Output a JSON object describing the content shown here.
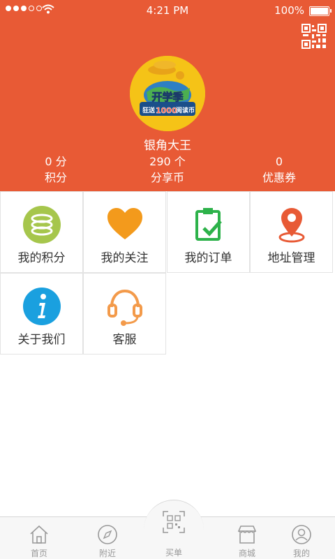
{
  "status_bar": {
    "time": "4:21 PM",
    "battery": "100%"
  },
  "profile": {
    "username": "银角大王",
    "avatar_text": "开学季",
    "avatar_subtext_a": "狂送",
    "avatar_subtext_num": "1000",
    "avatar_subtext_b": "阅读币"
  },
  "stats": [
    {
      "value": "0 分",
      "label": "积分"
    },
    {
      "value": "290 个",
      "label": "分享币"
    },
    {
      "value": "0",
      "label": "优惠券"
    }
  ],
  "menu": [
    {
      "label": "我的积分",
      "icon": "coins-icon",
      "color": "#a6c64c"
    },
    {
      "label": "我的关注",
      "icon": "heart-icon",
      "color": "#f39a1c"
    },
    {
      "label": "我的订单",
      "icon": "clipboard-check-icon",
      "color": "#2db24a"
    },
    {
      "label": "地址管理",
      "icon": "location-pin-icon",
      "color": "#e85a35"
    },
    {
      "label": "关于我们",
      "icon": "info-icon",
      "color": "#1aa0df"
    },
    {
      "label": "客服",
      "icon": "headset-icon",
      "color": "#f39a4a"
    }
  ],
  "tabbar": [
    {
      "label": "首页",
      "icon": "home-icon"
    },
    {
      "label": "附近",
      "icon": "compass-icon"
    },
    {
      "label": "买单",
      "icon": "scan-icon"
    },
    {
      "label": "商城",
      "icon": "shop-icon"
    },
    {
      "label": "我的",
      "icon": "user-icon"
    }
  ],
  "colors": {
    "header": "#e85a35",
    "tab_text": "#999999"
  }
}
